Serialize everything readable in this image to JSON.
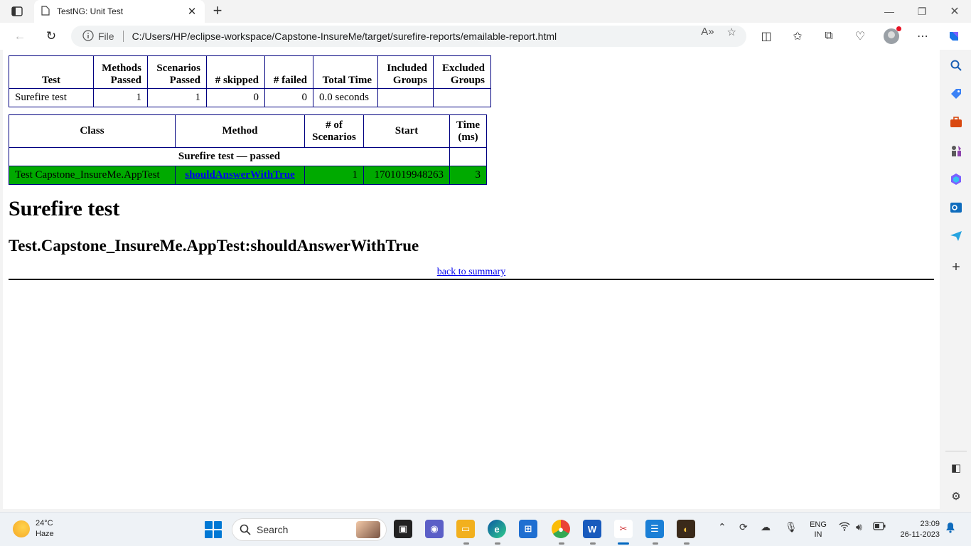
{
  "browser": {
    "tab_title": "TestNG: Unit Test",
    "address_label": "File",
    "url": "C:/Users/HP/eclipse-workspace/Capstone-InsureMe/target/surefire-reports/emailable-report.html"
  },
  "summary_table": {
    "headers": [
      "Test",
      "Methods Passed",
      "Scenarios Passed",
      "# skipped",
      "# failed",
      "Total Time",
      "Included Groups",
      "Excluded Groups"
    ],
    "row": {
      "test": "Surefire test",
      "methods_passed": "1",
      "scenarios_passed": "1",
      "skipped": "0",
      "failed": "0",
      "total_time": "0.0 seconds",
      "included_groups": "",
      "excluded_groups": ""
    }
  },
  "detail_table": {
    "headers": [
      "Class",
      "Method",
      "# of Scenarios",
      "Start",
      "Time (ms)"
    ],
    "group_label": "Surefire test — passed",
    "row": {
      "class": "Test Capstone_InsureMe.AppTest",
      "method": "shouldAnswerWithTrue",
      "scenarios": "1",
      "start": "1701019948263",
      "time_ms": "3"
    },
    "pass_color": "#00aa00"
  },
  "suite_heading": "Surefire test",
  "method_heading": "Test.Capstone_InsureMe.AppTest:shouldAnswerWithTrue",
  "back_link": "back to summary",
  "taskbar": {
    "temperature": "24°C",
    "condition": "Haze",
    "search_label": "Search",
    "lang_1": "ENG",
    "lang_2": "IN",
    "time": "23:09",
    "date": "26-11-2023"
  },
  "colors": {
    "table_border": "#000080",
    "link": "#0000ee",
    "accent": "#0078d4"
  }
}
